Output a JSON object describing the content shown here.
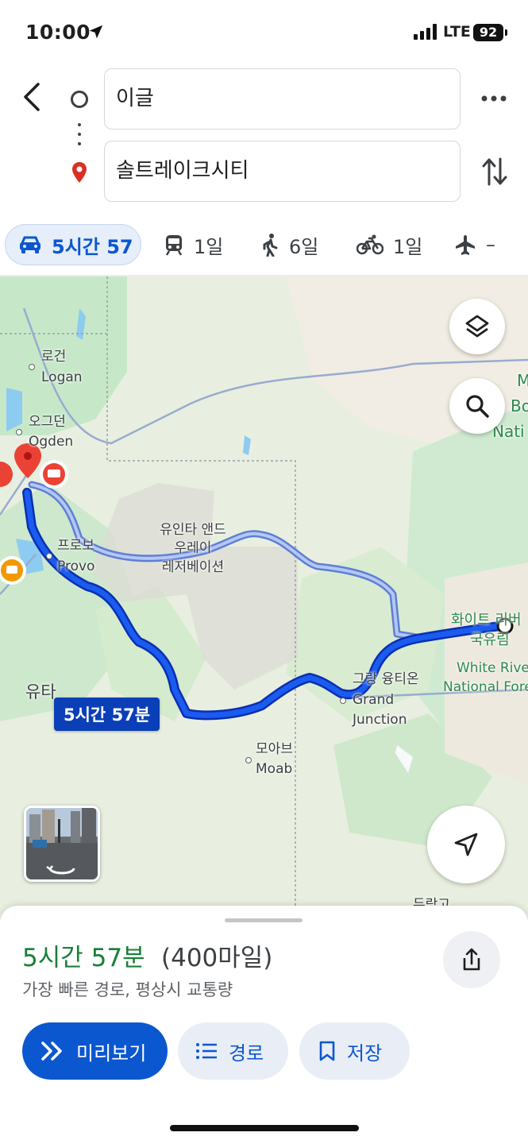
{
  "status_bar": {
    "time": "10:00",
    "network": "LTE",
    "battery": "92"
  },
  "search": {
    "origin": "이글",
    "destination": "솔트레이크시티",
    "back_icon": "chevron-left-icon",
    "more_icon": "more-horiz-icon",
    "swap_icon": "swap-vert-icon"
  },
  "modes": [
    {
      "icon": "car-icon",
      "label": "5시간 57",
      "active": true
    },
    {
      "icon": "train-icon",
      "label": "1일"
    },
    {
      "icon": "walk-icon",
      "label": "6일"
    },
    {
      "icon": "bike-icon",
      "label": "1일"
    },
    {
      "icon": "flight-icon",
      "label": "–"
    }
  ],
  "map": {
    "labels": {
      "logan_ko": "로건",
      "logan_en": "Logan",
      "ogden_ko": "오그던",
      "ogden_en": "Ogden",
      "provo_ko": "프로보",
      "provo_en": "Provo",
      "uintah_1": "유인타 앤드",
      "uintah_2": "우레이",
      "uintah_3": "레저베이션",
      "utah": "유타",
      "gj_ko": "그랑 융티온",
      "gj_en_1": "Grand",
      "gj_en_2": "Junction",
      "moab_ko": "모아브",
      "moab_en": "Moab",
      "wr_ko_1": "화이트 리버",
      "wr_ko_2": "국유림",
      "wr_en_1": "White River",
      "wr_en_2": "National Fore",
      "nat_1": "M",
      "nat_2": "Bo",
      "nat_3": "Nati",
      "durango": "듀랑고"
    },
    "route_badge": "5시간 57분",
    "route_color": "#1a4fd6",
    "alt_route_color": "#8aa6e8"
  },
  "summary": {
    "duration": "5시간 57분",
    "distance": "(400마일)",
    "description": "가장 빠른 경로, 평상시 교통량",
    "duration_color": "#188038"
  },
  "actions": {
    "preview": "미리보기",
    "steps": "경로",
    "save": "저장"
  }
}
